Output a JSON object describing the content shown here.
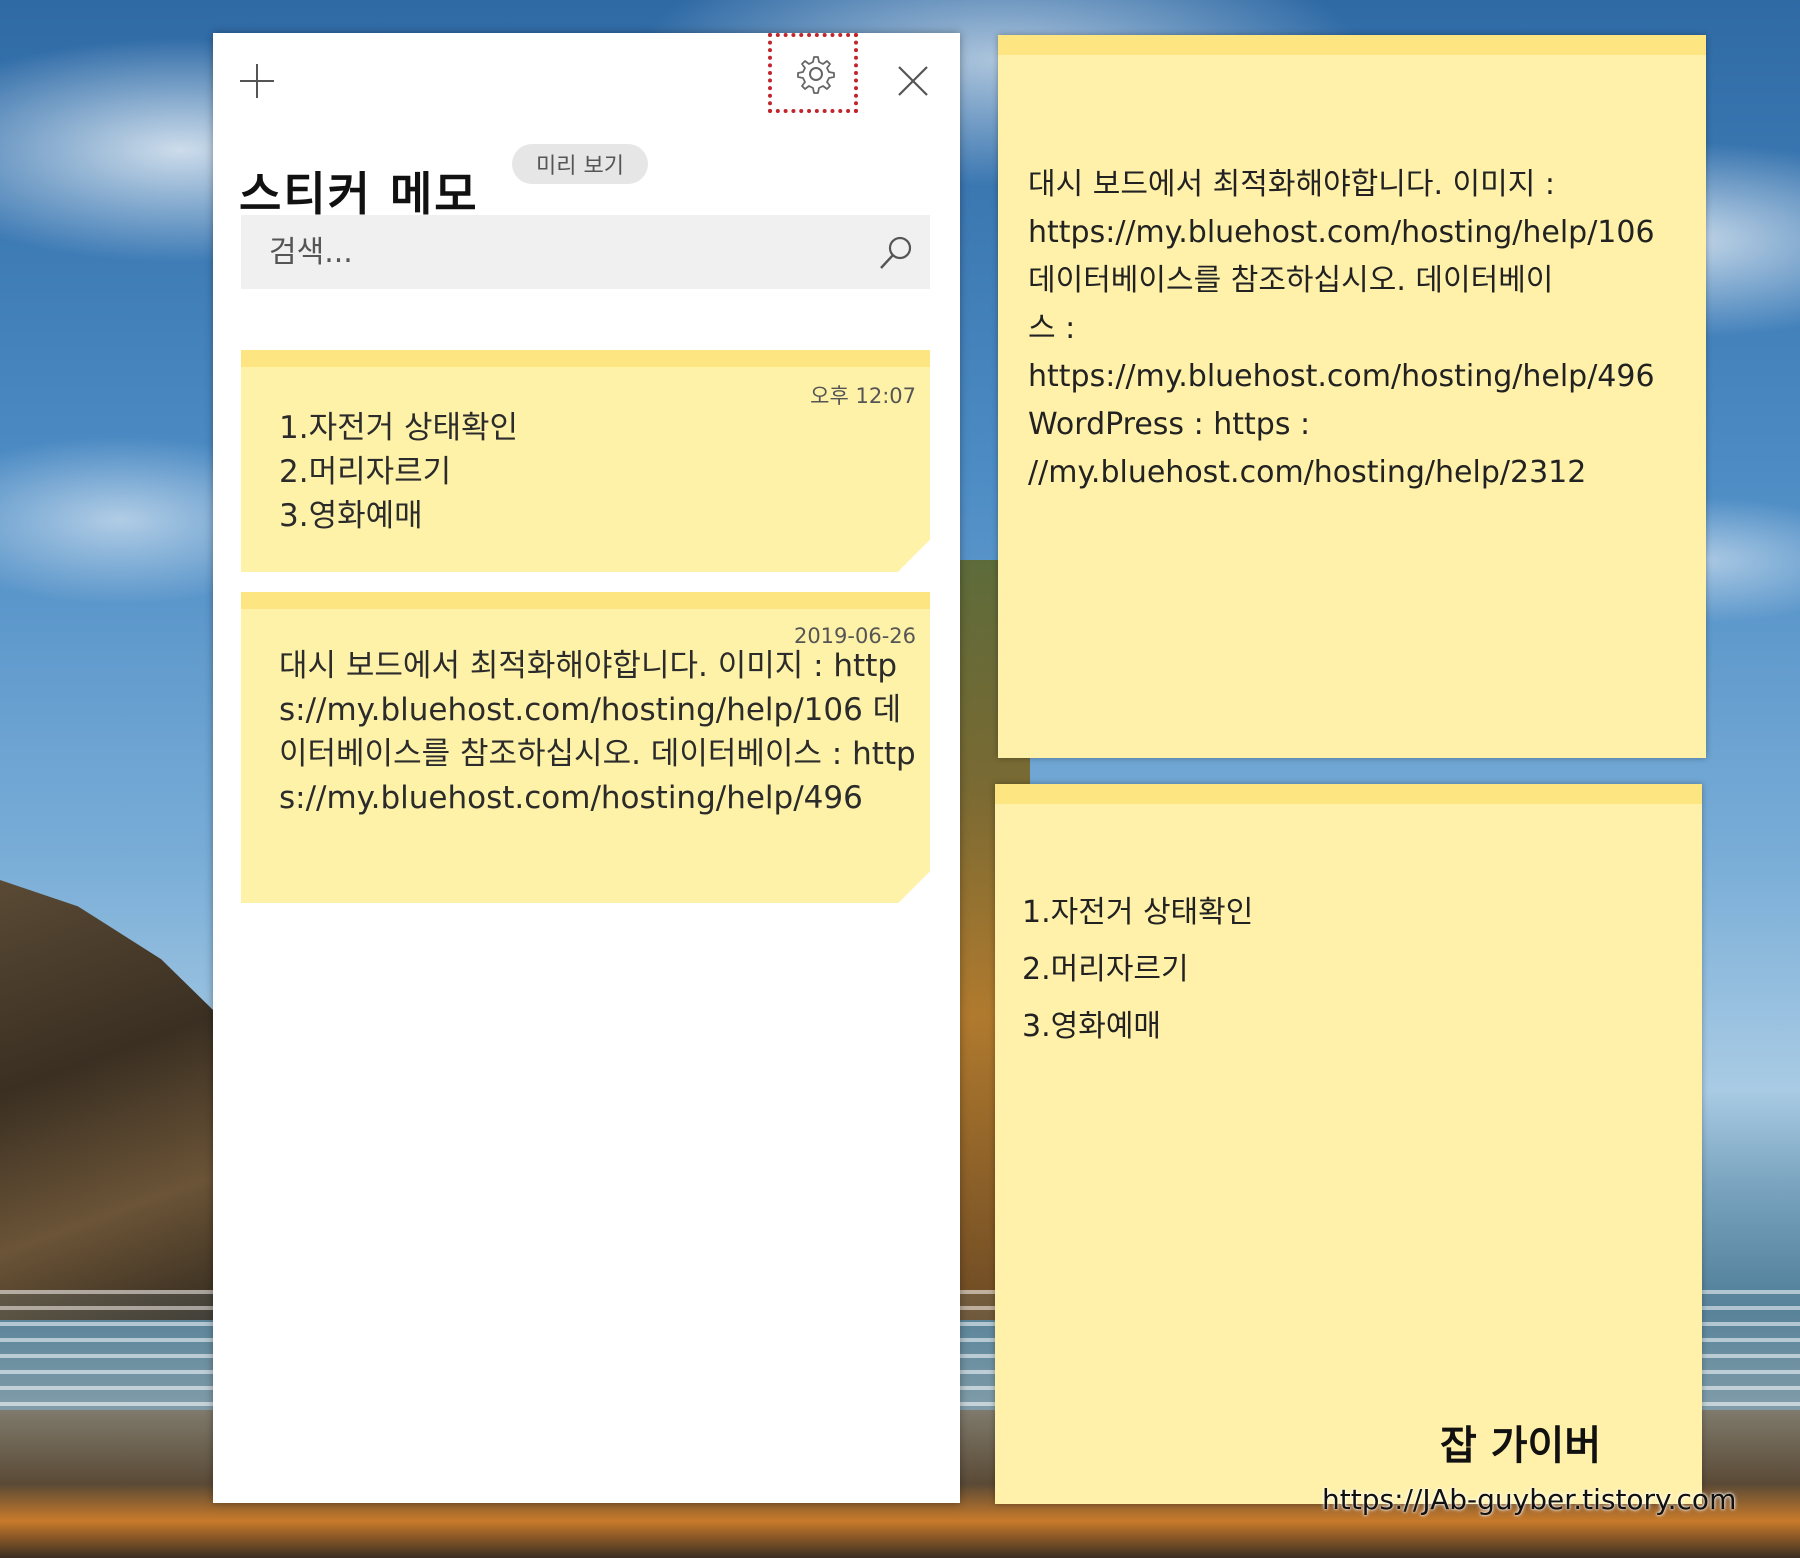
{
  "panel": {
    "title": "스티커 메모",
    "preview_badge": "미리 보기",
    "search_placeholder": "검색...",
    "icons": {
      "add": "plus-icon",
      "settings": "gear-icon",
      "close": "close-icon",
      "search": "search-icon"
    },
    "notes": [
      {
        "date": "오후 12:07",
        "body": "1.자전거 상태확인\n2.머리자르기\n3.영화예매"
      },
      {
        "date": "2019-06-26",
        "body": "대시 보드에서 최적화해야합니다. 이미지 : https://my.bluehost.com/hosting/help/106 데이터베이스를 참조하십시오. 데이터베이스 : https://my.bluehost.com/hosting/help/496"
      }
    ]
  },
  "open_notes": [
    {
      "body": "대시 보드에서 최적화해야합니다. 이미지 :\nhttps://my.bluehost.com/hosting/help/106\n데이터베이스를 참조하십시오. 데이터베이\n스 :\nhttps://my.bluehost.com/hosting/help/496\nWordPress : https :\n//my.bluehost.com/hosting/help/2312"
    },
    {
      "body": "1.자전거 상태확인\n2.머리자르기\n3.영화예매"
    }
  ],
  "watermark": {
    "name": "잡 가이버",
    "url": "https://JAb-guyber.tistory.com"
  },
  "colors": {
    "note_yellow": "#fef2a8",
    "note_band": "#fde681",
    "highlight": "#c0262c"
  }
}
